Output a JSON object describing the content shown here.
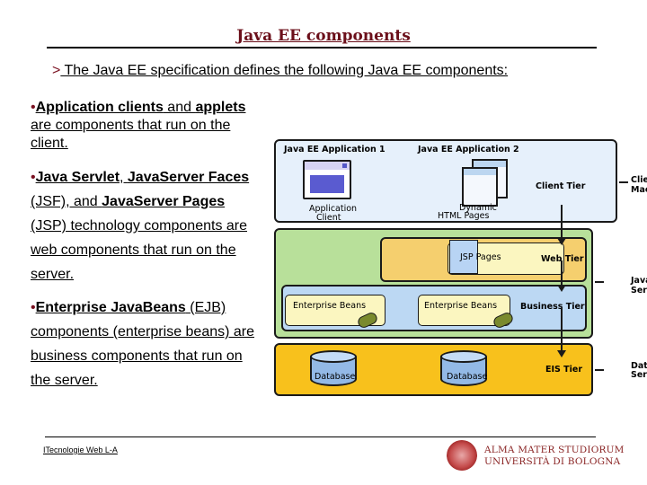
{
  "slide": {
    "title": "Java EE components",
    "subtitle_marker": ">",
    "subtitle": " The Java EE specification defines the following Java EE components:",
    "bullets": [
      {
        "marker": "•",
        "segments": [
          {
            "text": "Application clients",
            "bold": true
          },
          {
            "text": " and ",
            "bold": false
          },
          {
            "text": "applets",
            "bold": true
          },
          {
            "text": " are components that run on the client.",
            "bold": false
          }
        ]
      },
      {
        "marker": "•",
        "segments": [
          {
            "text": "Java Servlet",
            "bold": true
          },
          {
            "text": ", ",
            "bold": false
          },
          {
            "text": "JavaServer Faces",
            "bold": true
          },
          {
            "text": " (JSF), and ",
            "bold": false
          },
          {
            "text": "JavaServer Pages",
            "bold": true
          },
          {
            "text": " (JSP) technology components are web components that run on the server.",
            "bold": false
          }
        ]
      },
      {
        "marker": "•",
        "segments": [
          {
            "text": "Enterprise JavaBeans",
            "bold": true
          },
          {
            "text": " (EJB) components (enterprise beans) are business components that run on the server.",
            "bold": false
          }
        ]
      }
    ],
    "footer": {
      "course": "ITecnologie Web L-A",
      "logo_line1": "ALMA MATER STUDIORUM",
      "logo_line2": "UNIVERSITÀ DI BOLOGNA"
    }
  },
  "diagram": {
    "app1_title": "Java EE Application 1",
    "app2_title": "Java EE Application 2",
    "app_client_label_1": "Application",
    "app_client_label_2": "Client",
    "dynamic_html_1": "Dynamic",
    "dynamic_html_2": "HTML Pages",
    "client_tier": "Client Tier",
    "web_tier": "Web Tier",
    "business_tier": "Business Tier",
    "eis_tier": "EIS Tier",
    "jsp_pages": "JSP Pages",
    "enterprise_beans_1": "Enterprise Beans",
    "enterprise_beans_2": "Enterprise Beans",
    "database_1": "Database",
    "database_2": "Database",
    "client_machine_1": "Client",
    "client_machine_2": "Machine",
    "javaee_server_1": "Java EE",
    "javaee_server_2": "Server",
    "db_server_1": "Database",
    "db_server_2": "Server",
    "colors": {
      "client_tier": "#e6f0fb",
      "server": "#b8e09a",
      "web_tier": "#f5cf6e",
      "business_tier": "#bcd8f3",
      "eis_tier": "#f8c11c",
      "title": "#6b0f1a"
    }
  }
}
